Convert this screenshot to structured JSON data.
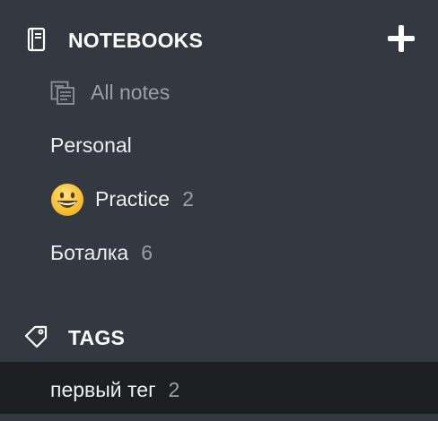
{
  "notebooks": {
    "title": "NOTEBOOKS",
    "header_icon": "notebook-icon",
    "add_icon": "plus-icon",
    "items": [
      {
        "label": "All notes",
        "icon": "all-notes-icon",
        "count": ""
      },
      {
        "label": "Personal",
        "icon": "",
        "count": ""
      },
      {
        "label": "Practice",
        "icon": "grinning-face-emoji",
        "count": "2"
      },
      {
        "label": "Боталка",
        "icon": "",
        "count": "6"
      }
    ]
  },
  "tags": {
    "title": "TAGS",
    "header_icon": "tag-icon",
    "items": [
      {
        "label": "первый тег",
        "count": "2",
        "selected": true
      }
    ]
  },
  "colors": {
    "background": "#343841",
    "selected_row": "#1d1e22",
    "text_primary": "#eceef1",
    "text_muted": "#9a9ea6"
  }
}
